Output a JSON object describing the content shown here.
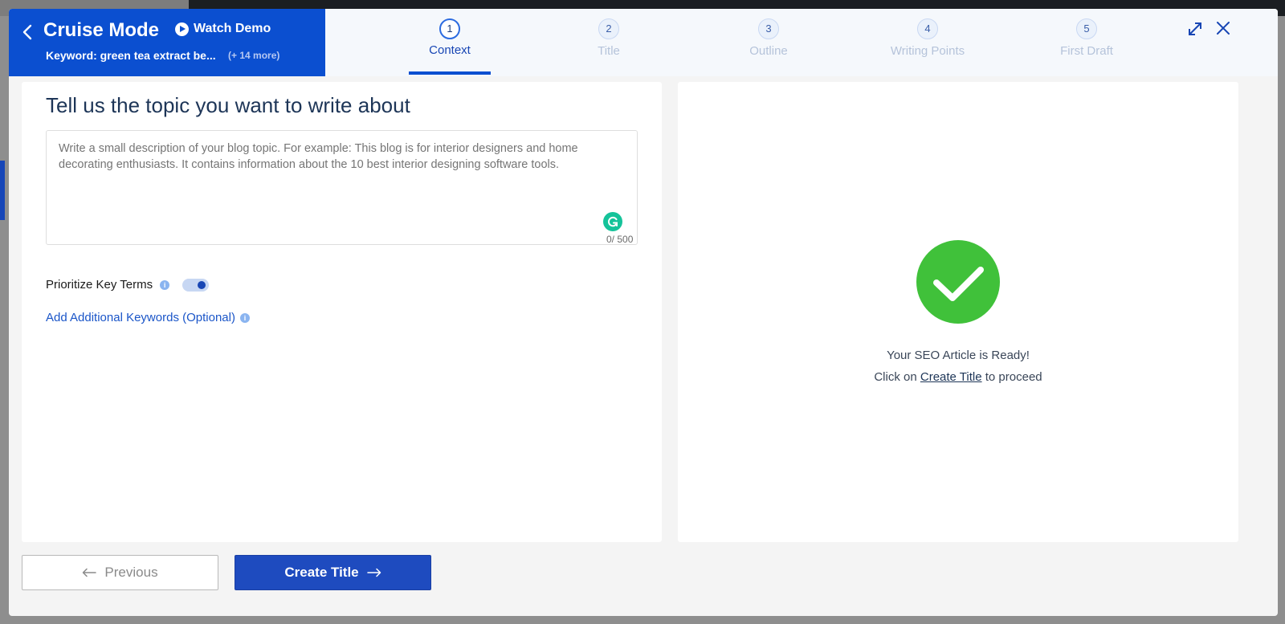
{
  "header": {
    "title": "Cruise Mode",
    "watch_demo": "Watch Demo",
    "keyword": "Keyword: green tea extract be...",
    "keyword_more": "(+ 14 more)"
  },
  "steps": [
    {
      "num": "1",
      "label": "Context",
      "active": true
    },
    {
      "num": "2",
      "label": "Title",
      "active": false
    },
    {
      "num": "3",
      "label": "Outline",
      "active": false
    },
    {
      "num": "4",
      "label": "Writing Points",
      "active": false
    },
    {
      "num": "5",
      "label": "First Draft",
      "active": false
    }
  ],
  "left": {
    "heading": "Tell us the topic you want to write about",
    "placeholder": "Write a small description of your blog topic. For example: This blog is for interior designers and home decorating enthusiasts. It contains information about the 10 best interior designing software tools.",
    "char_count": "0/ 500",
    "prioritize_label": "Prioritize Key Terms",
    "prioritize_enabled": true,
    "add_keywords": "Add Additional Keywords (Optional)"
  },
  "right": {
    "ready": "Your SEO Article is Ready!",
    "proceed_prefix": "Click on ",
    "proceed_link": "Create Title",
    "proceed_suffix": " to proceed"
  },
  "footer": {
    "previous": "Previous",
    "create_title": "Create Title"
  },
  "colors": {
    "brand_blue": "#0b4fd0",
    "success_green": "#40c13a",
    "button_blue": "#1e4bbf"
  }
}
